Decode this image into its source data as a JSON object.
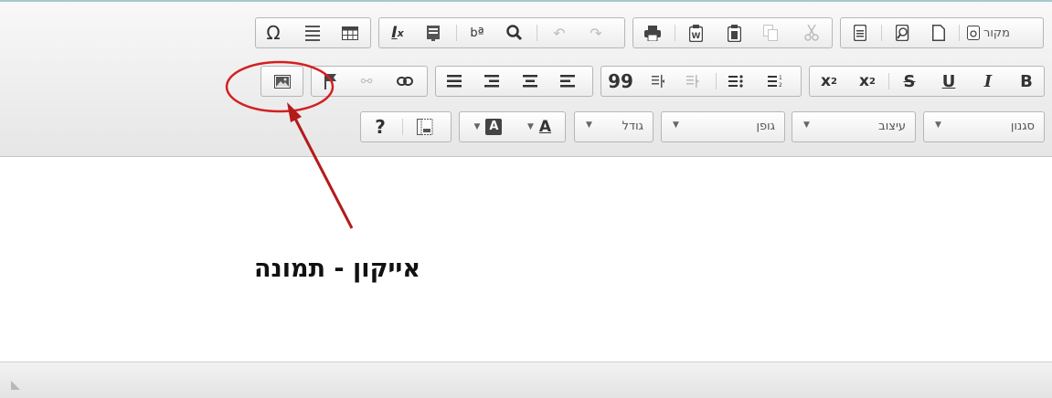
{
  "toolbar": {
    "row1": {
      "source_label": "מקור",
      "source_icon": "source-icon",
      "icons": [
        "omega-icon",
        "horizontal-rule-icon",
        "table-icon",
        "remove-format-icon",
        "paste-plain-icon",
        "find-replace-icon",
        "search-icon",
        "undo-icon",
        "redo-icon",
        "print-icon",
        "paste-word-icon",
        "paste-icon",
        "copy-icon",
        "cut-icon",
        "preview-icon",
        "templates-icon",
        "new-page-icon"
      ]
    },
    "row2": {
      "bold": "B",
      "italic": "I",
      "underline": "U",
      "strike": "S",
      "subscript": "x",
      "superscript": "x",
      "sub_mark": "2",
      "sup_mark": "2",
      "quote": "99"
    },
    "row3": {
      "styles_label": "סגנון",
      "format_label": "עיצוב",
      "font_label": "גופן",
      "size_label": "גודל",
      "help_label": "?",
      "text_color_label": "A",
      "bg_color_label": "A"
    }
  },
  "annotation": {
    "text": "אייקון - תמונה",
    "highlight_color": "#d32020"
  }
}
